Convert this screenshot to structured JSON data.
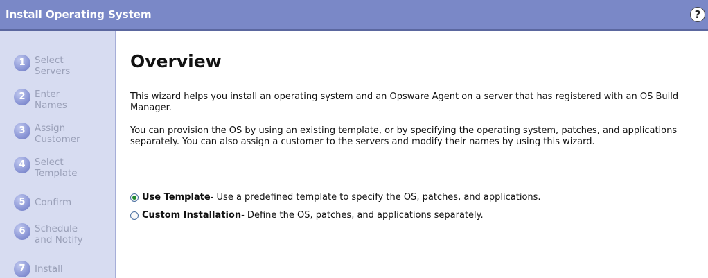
{
  "window": {
    "title": "Install Operating System",
    "help_label": "?"
  },
  "steps": [
    {
      "num": "1",
      "label": "Select\nServers"
    },
    {
      "num": "2",
      "label": "Enter\nNames"
    },
    {
      "num": "3",
      "label": "Assign\nCustomer"
    },
    {
      "num": "4",
      "label": "Select\nTemplate"
    },
    {
      "num": "5",
      "label": "Confirm"
    },
    {
      "num": "6",
      "label": "Schedule\nand Notify"
    },
    {
      "num": "7",
      "label": "Install"
    }
  ],
  "main": {
    "heading": "Overview",
    "paragraph1": "This wizard helps you install an operating system and an Opsware Agent on a server that has registered with an OS Build Manager.",
    "paragraph2": "You can provision the OS by using an existing template, or by specifying the operating system, patches, and applications separately. You can also assign a customer to the servers and modify their names by using this wizard."
  },
  "options": [
    {
      "title": "Use Template",
      "desc": " - Use a predefined template to specify the OS, patches, and applications.",
      "selected": true
    },
    {
      "title": "Custom Installation",
      "desc": " - Define the OS, patches, and applications separately.",
      "selected": false
    }
  ],
  "colors": {
    "titlebar": "#7a88c7",
    "sidebar": "#d7dcf1",
    "step_circle": "#8f9ad8"
  }
}
